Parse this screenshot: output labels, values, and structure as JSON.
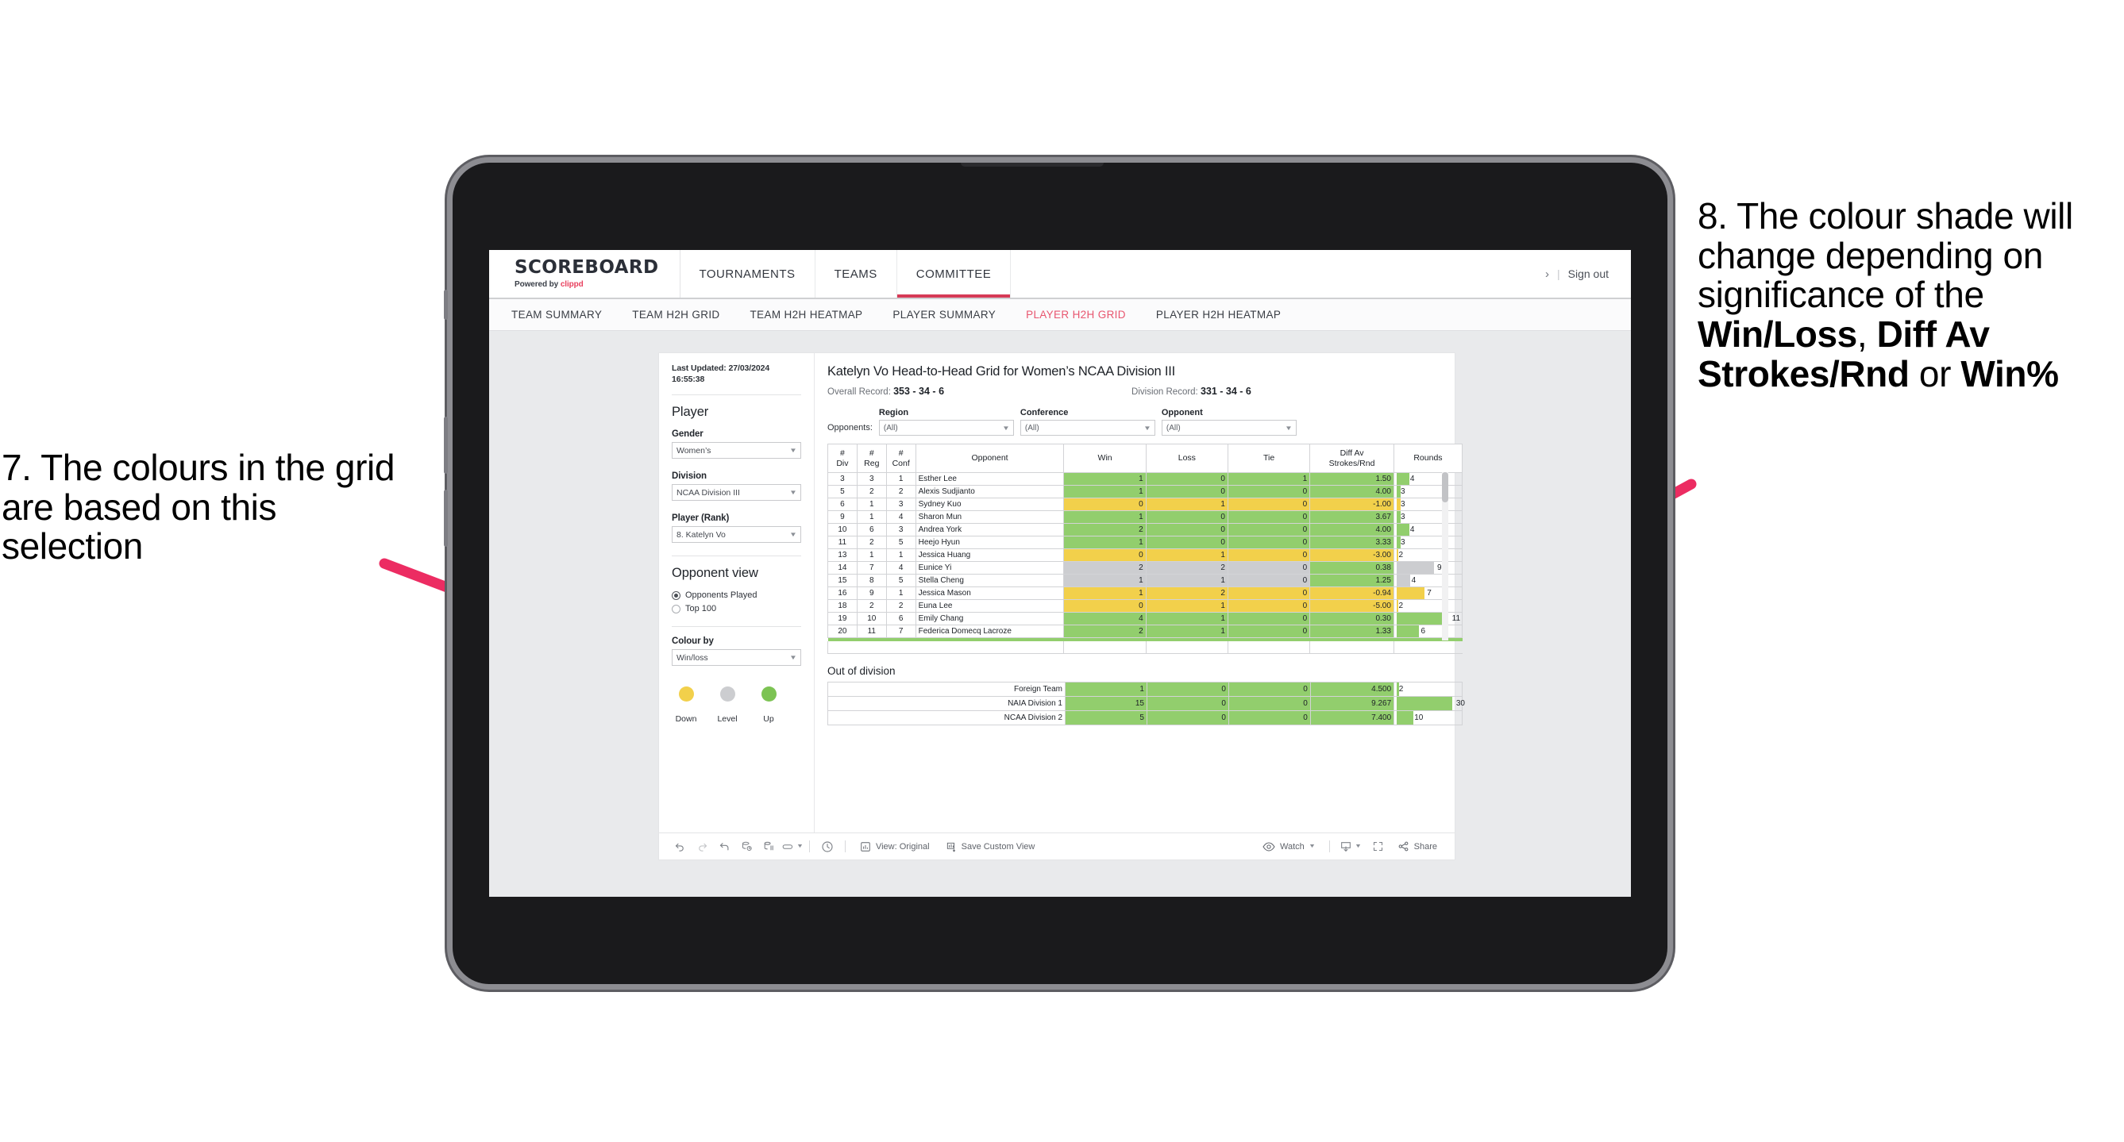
{
  "annotations": {
    "left": {
      "id": "7.",
      "text": "7. The colours in the grid are based on this selection"
    },
    "right": {
      "lead": "8. The colour shade will change depending on significance of the ",
      "bold1": "Win/Loss",
      "mid1": ", ",
      "bold2": "Diff Av Strokes/Rnd",
      "mid2": " or ",
      "bold3": "Win%"
    },
    "arrow_color": "#ec2c62"
  },
  "header": {
    "brand_title": "SCOREBOARD",
    "brand_sub_prefix": "Powered by ",
    "brand_sub_name": "clippd",
    "nav": [
      {
        "label": "TOURNAMENTS",
        "active": false
      },
      {
        "label": "TEAMS",
        "active": false
      },
      {
        "label": "COMMITTEE",
        "active": true
      }
    ],
    "chevron": "›",
    "divider": "|",
    "sign_out": "Sign out"
  },
  "subnav": [
    {
      "label": "TEAM SUMMARY",
      "active": false
    },
    {
      "label": "TEAM H2H GRID",
      "active": false
    },
    {
      "label": "TEAM H2H HEATMAP",
      "active": false
    },
    {
      "label": "PLAYER SUMMARY",
      "active": false
    },
    {
      "label": "PLAYER H2H GRID",
      "active": true
    },
    {
      "label": "PLAYER H2H HEATMAP",
      "active": false
    }
  ],
  "sidebar": {
    "last_updated": "Last Updated: 27/03/2024 16:55:38",
    "player_heading": "Player",
    "gender": {
      "label": "Gender",
      "value": "Women’s"
    },
    "division": {
      "label": "Division",
      "value": "NCAA Division III"
    },
    "player_rank": {
      "label": "Player (Rank)",
      "value": "8. Katelyn Vo"
    },
    "opponent_view": {
      "heading": "Opponent view",
      "options": [
        {
          "label": "Opponents Played",
          "selected": true
        },
        {
          "label": "Top 100",
          "selected": false
        }
      ]
    },
    "colour_by": {
      "label": "Colour by",
      "value": "Win/loss"
    },
    "legend": [
      {
        "label": "Down",
        "color": "#f2d04b"
      },
      {
        "label": "Level",
        "color": "#cccdd0"
      },
      {
        "label": "Up",
        "color": "#92ce6d"
      }
    ]
  },
  "main": {
    "title": "Katelyn Vo Head-to-Head Grid for Women’s NCAA Division III",
    "overall_record_label": "Overall Record: ",
    "overall_record_value": "353 -  34 - 6",
    "division_record_label": "Division Record: ",
    "division_record_value": "331 -  34 - 6",
    "opponents_label": "Opponents:",
    "filters": [
      {
        "label": "Region",
        "value": "(All)"
      },
      {
        "label": "Conference",
        "value": "(All)"
      },
      {
        "label": "Opponent",
        "value": "(All)"
      }
    ],
    "columns": [
      {
        "l1": "#",
        "l2": "Div"
      },
      {
        "l1": "#",
        "l2": "Reg"
      },
      {
        "l1": "#",
        "l2": "Conf"
      },
      {
        "l1": "Opponent",
        "l2": ""
      },
      {
        "l1": "Win",
        "l2": ""
      },
      {
        "l1": "Loss",
        "l2": ""
      },
      {
        "l1": "Tie",
        "l2": ""
      },
      {
        "l1": "Diff Av",
        "l2": "Strokes/Rnd"
      },
      {
        "l1": "Rounds",
        "l2": ""
      }
    ],
    "rows": [
      {
        "div": "3",
        "reg": "3",
        "conf": "1",
        "opponent": "Esther Lee",
        "win": "1",
        "loss": "0",
        "tie": "1",
        "diff": "1.50",
        "rounds": "4",
        "color": "green",
        "bar": 20
      },
      {
        "div": "5",
        "reg": "2",
        "conf": "2",
        "opponent": "Alexis Sudjianto",
        "win": "1",
        "loss": "0",
        "tie": "0",
        "diff": "4.00",
        "rounds": "3",
        "color": "green",
        "bar": 6
      },
      {
        "div": "6",
        "reg": "1",
        "conf": "3",
        "opponent": "Sydney Kuo",
        "win": "0",
        "loss": "1",
        "tie": "0",
        "diff": "-1.00",
        "rounds": "3",
        "color": "yellow",
        "bar": 6
      },
      {
        "div": "9",
        "reg": "1",
        "conf": "4",
        "opponent": "Sharon Mun",
        "win": "1",
        "loss": "0",
        "tie": "0",
        "diff": "3.67",
        "rounds": "3",
        "color": "green",
        "bar": 6
      },
      {
        "div": "10",
        "reg": "6",
        "conf": "3",
        "opponent": "Andrea York",
        "win": "2",
        "loss": "0",
        "tie": "0",
        "diff": "4.00",
        "rounds": "4",
        "color": "green",
        "bar": 20
      },
      {
        "div": "11",
        "reg": "2",
        "conf": "5",
        "opponent": "Heejo Hyun",
        "win": "1",
        "loss": "0",
        "tie": "0",
        "diff": "3.33",
        "rounds": "3",
        "color": "green",
        "bar": 6
      },
      {
        "div": "13",
        "reg": "1",
        "conf": "1",
        "opponent": "Jessica Huang",
        "win": "0",
        "loss": "1",
        "tie": "0",
        "diff": "-3.00",
        "rounds": "2",
        "color": "yellow",
        "bar": 3
      },
      {
        "div": "14",
        "reg": "7",
        "conf": "4",
        "opponent": "Eunice Yi",
        "win": "2",
        "loss": "2",
        "tie": "0",
        "diff": "0.38",
        "rounds": "9",
        "color": "grey",
        "bar": 60,
        "diff_color": "green"
      },
      {
        "div": "15",
        "reg": "8",
        "conf": "5",
        "opponent": "Stella Cheng",
        "win": "1",
        "loss": "1",
        "tie": "0",
        "diff": "1.25",
        "rounds": "4",
        "color": "grey",
        "bar": 22,
        "diff_color": "green"
      },
      {
        "div": "16",
        "reg": "9",
        "conf": "1",
        "opponent": "Jessica Mason",
        "win": "1",
        "loss": "2",
        "tie": "0",
        "diff": "-0.94",
        "rounds": "7",
        "color": "yellow",
        "bar": 45
      },
      {
        "div": "18",
        "reg": "2",
        "conf": "2",
        "opponent": "Euna Lee",
        "win": "0",
        "loss": "1",
        "tie": "0",
        "diff": "-5.00",
        "rounds": "2",
        "color": "yellow",
        "bar": 3
      },
      {
        "div": "19",
        "reg": "10",
        "conf": "6",
        "opponent": "Emily Chang",
        "win": "4",
        "loss": "1",
        "tie": "0",
        "diff": "0.30",
        "rounds": "11",
        "color": "green",
        "bar": 82
      },
      {
        "div": "20",
        "reg": "11",
        "conf": "7",
        "opponent": "Federica Domecq Lacroze",
        "win": "2",
        "loss": "1",
        "tie": "0",
        "diff": "1.33",
        "rounds": "6",
        "color": "green",
        "bar": 36
      }
    ],
    "out_of_division": {
      "title": "Out of division",
      "rows": [
        {
          "label": "Foreign Team",
          "win": "1",
          "loss": "0",
          "tie": "0",
          "diff": "4.500",
          "rounds": "2",
          "color": "green",
          "bar": 3
        },
        {
          "label": "NAIA Division 1",
          "win": "15",
          "loss": "0",
          "tie": "0",
          "diff": "9.267",
          "rounds": "30",
          "color": "green",
          "bar": 88
        },
        {
          "label": "NCAA Division 2",
          "win": "5",
          "loss": "0",
          "tie": "0",
          "diff": "7.400",
          "rounds": "10",
          "color": "green",
          "bar": 26
        }
      ]
    }
  },
  "toolbar": {
    "icons": [
      "undo-icon",
      "redo-icon",
      "revert-icon",
      "refresh-icon",
      "pause-icon",
      "highlight-icon"
    ],
    "view_label": "View: Original",
    "save_label": "Save Custom View",
    "watch_label": "Watch",
    "share_label": "Share"
  },
  "colors": {
    "accent_pink": "#e8566f",
    "brand_red": "#e8415f",
    "green": "#92ce6d",
    "yellow": "#f2d04b",
    "grey": "#cccdd0",
    "arrow": "#ec2c62"
  }
}
